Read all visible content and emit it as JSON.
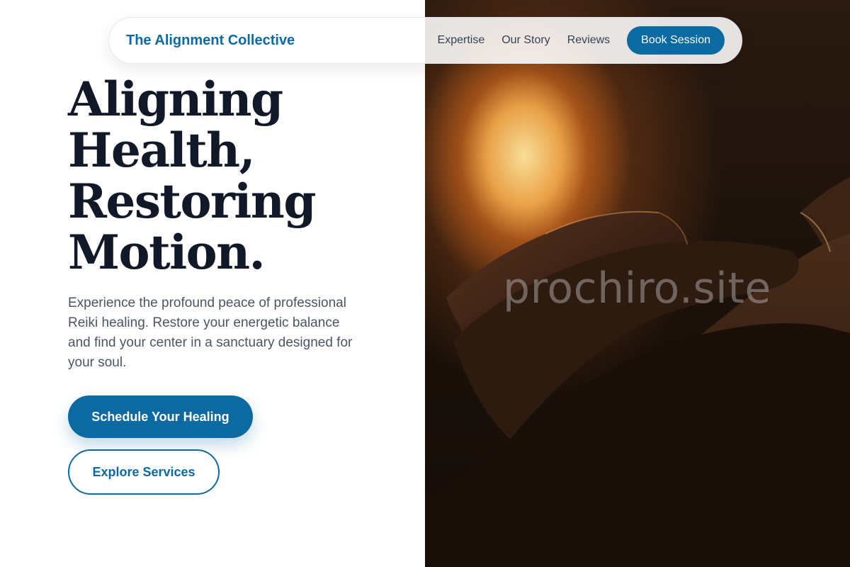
{
  "nav": {
    "brand": "The Alignment Collective",
    "links": [
      "Expertise",
      "Our Story",
      "Reviews"
    ],
    "cta": "Book Session"
  },
  "hero": {
    "title_lines": [
      "Aligning",
      "Health,",
      "Restoring",
      "Motion."
    ],
    "description": "Experience the profound peace of professional Reiki healing. Restore your energetic balance and find your center in a sanctuary designed for your soul.",
    "primary_button": "Schedule Your Healing",
    "secondary_button": "Explore Services"
  },
  "image": {
    "watermark": "prochiro.site",
    "subject": "hands-on-face-photo"
  },
  "colors": {
    "brand": "#0b6aa2",
    "heading": "#111827",
    "body_text": "#4b5563"
  }
}
